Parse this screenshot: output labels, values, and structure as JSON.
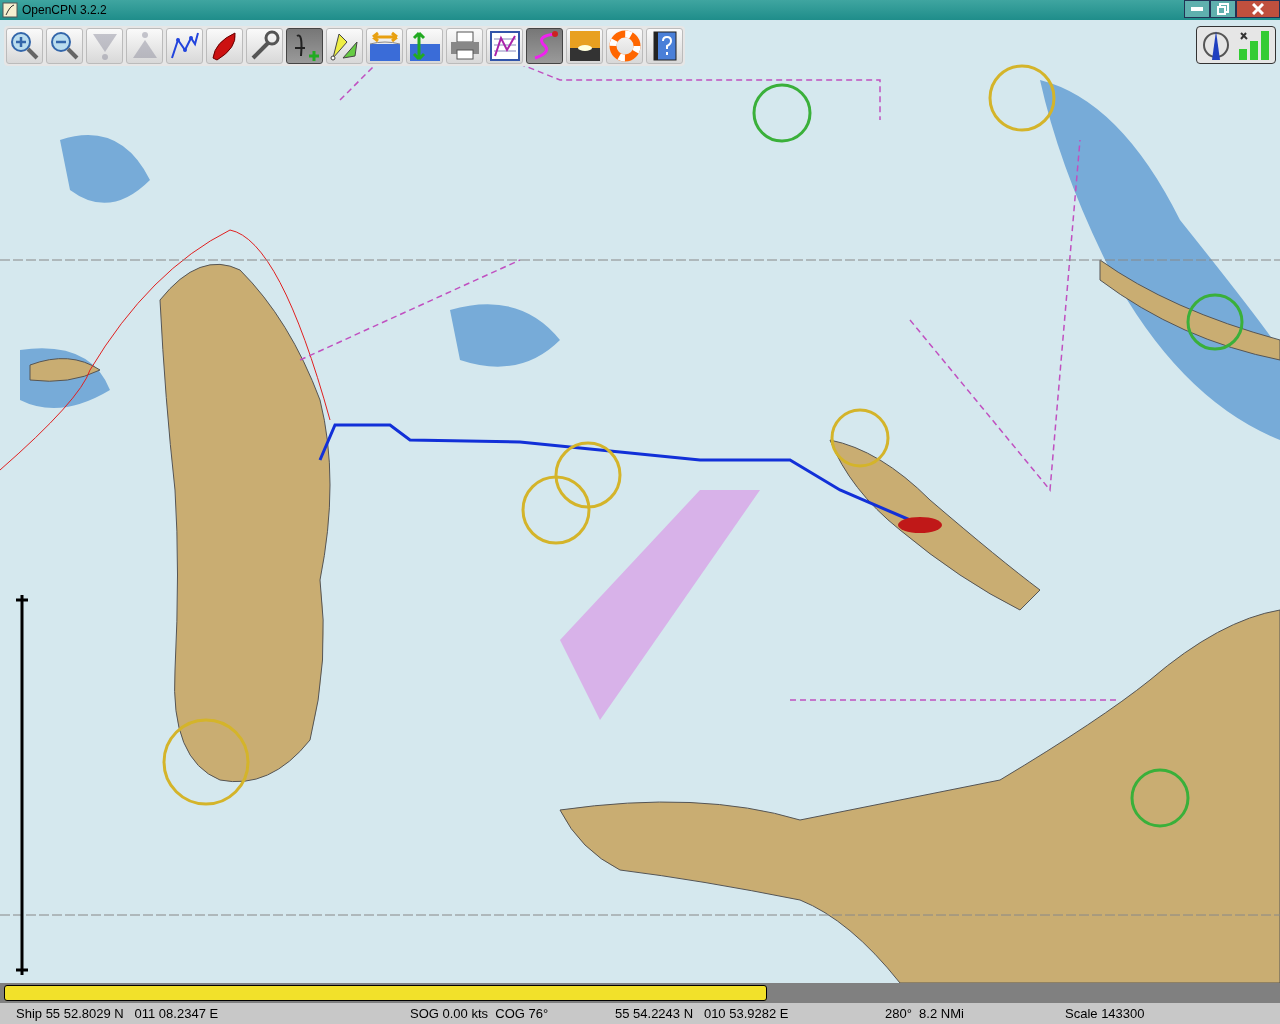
{
  "window": {
    "title": "OpenCPN 3.2.2"
  },
  "toolbar": [
    {
      "kind": "zoom-in",
      "disabled": false,
      "active": false
    },
    {
      "kind": "zoom-out",
      "disabled": false,
      "active": false
    },
    {
      "kind": "scale-down",
      "disabled": true,
      "active": false
    },
    {
      "kind": "scale-up",
      "disabled": true,
      "active": false
    },
    {
      "kind": "route",
      "disabled": false,
      "active": false
    },
    {
      "kind": "boat",
      "disabled": false,
      "active": false
    },
    {
      "kind": "settings",
      "disabled": false,
      "active": false
    },
    {
      "kind": "text",
      "disabled": false,
      "active": true
    },
    {
      "kind": "track",
      "disabled": false,
      "active": false
    },
    {
      "kind": "tide-width",
      "disabled": false,
      "active": false
    },
    {
      "kind": "tide-height",
      "disabled": false,
      "active": false
    },
    {
      "kind": "print",
      "disabled": false,
      "active": false
    },
    {
      "kind": "route-manager",
      "disabled": false,
      "active": false
    },
    {
      "kind": "track-line",
      "disabled": false,
      "active": true
    },
    {
      "kind": "sunset",
      "disabled": false,
      "active": false
    },
    {
      "kind": "lifebuoy",
      "disabled": false,
      "active": false
    },
    {
      "kind": "help",
      "disabled": false,
      "active": false
    }
  ],
  "progress": {
    "level": 0.6
  },
  "status_bar": [
    "Ship 55 52.8029 N   011 08.2347 E",
    "SOG 0.00 kts  COG 76°",
    "55 54.2243 N   010 53.9282 E",
    "280°  8.2 NMi",
    "Scale 143300"
  ]
}
